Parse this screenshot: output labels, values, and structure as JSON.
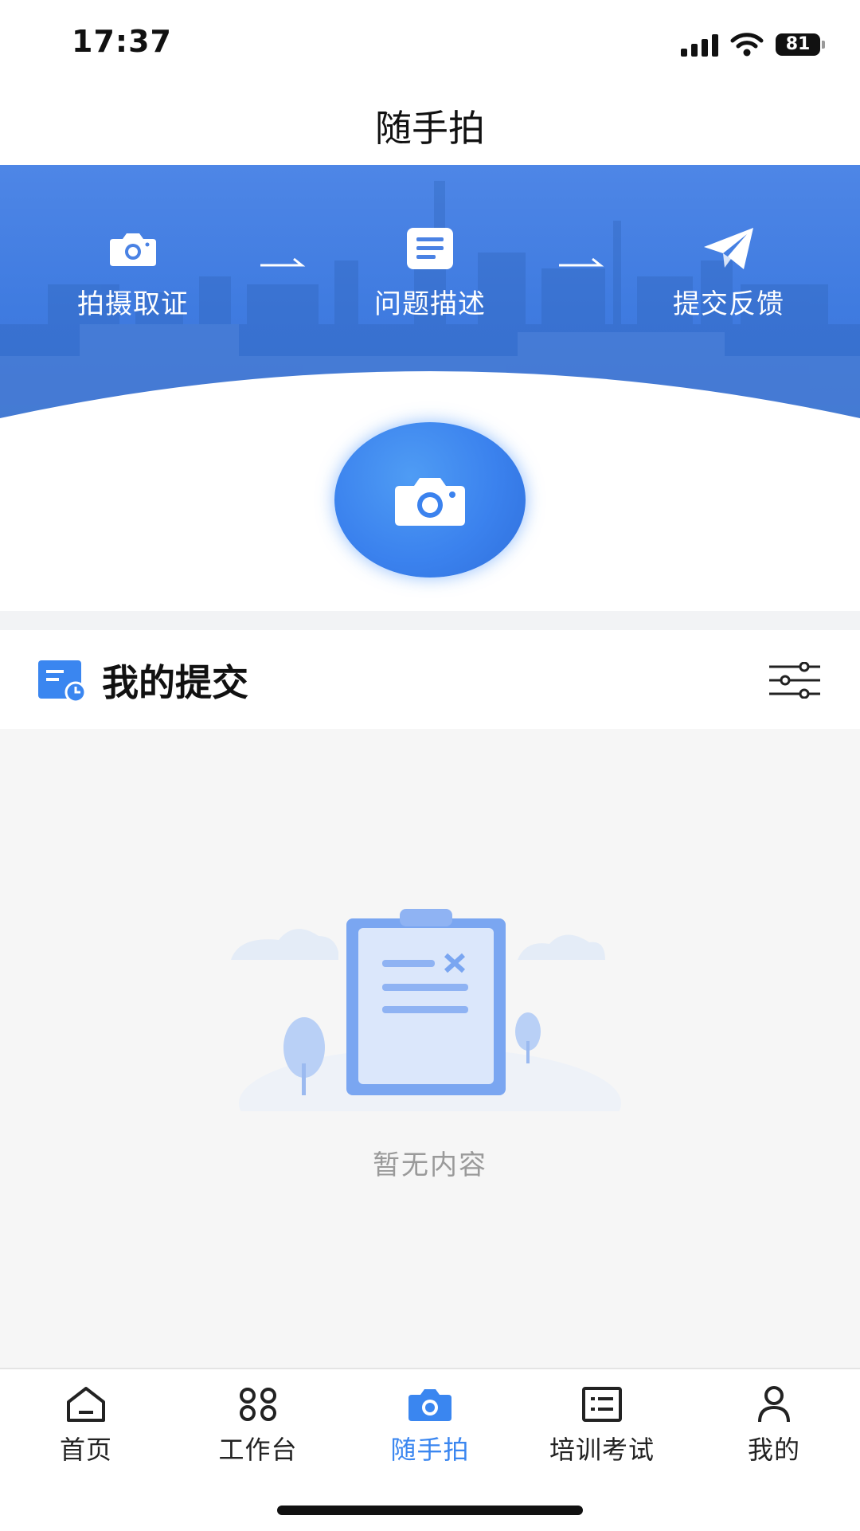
{
  "status_bar": {
    "time": "17:37",
    "battery": "81"
  },
  "nav": {
    "title": "随手拍"
  },
  "banner": {
    "steps": [
      {
        "label": "拍摄取证",
        "icon": "camera-icon"
      },
      {
        "label": "问题描述",
        "icon": "document-icon"
      },
      {
        "label": "提交反馈",
        "icon": "paper-plane-icon"
      }
    ]
  },
  "section": {
    "title": "我的提交"
  },
  "empty": {
    "text": "暂无内容"
  },
  "tabbar": {
    "items": [
      {
        "label": "首页",
        "icon": "home-icon"
      },
      {
        "label": "工作台",
        "icon": "workbench-icon"
      },
      {
        "label": "随手拍",
        "icon": "camera-icon",
        "active": true
      },
      {
        "label": "培训考试",
        "icon": "exam-icon"
      },
      {
        "label": "我的",
        "icon": "profile-icon"
      }
    ]
  },
  "colors": {
    "accent": "#3a86f0",
    "banner": "#4a82e4",
    "bg_gray": "#f6f6f6"
  }
}
